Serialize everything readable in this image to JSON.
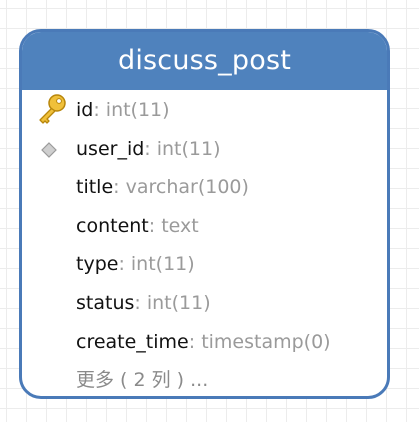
{
  "table": {
    "name": "discuss_post",
    "columns": [
      {
        "name": "id",
        "type": ": int(11)",
        "icon": "primary-key-icon"
      },
      {
        "name": "user_id",
        "type": ": int(11)",
        "icon": "index-diamond-icon"
      },
      {
        "name": "title",
        "type": ": varchar(100)",
        "icon": ""
      },
      {
        "name": "content",
        "type": ": text",
        "icon": ""
      },
      {
        "name": "type",
        "type": ": int(11)",
        "icon": ""
      },
      {
        "name": "status",
        "type": ": int(11)",
        "icon": ""
      },
      {
        "name": "create_time",
        "type": ": timestamp(0)",
        "icon": ""
      }
    ],
    "more_label": "更多 ( 2 列 ) ..."
  },
  "colors": {
    "header": "#4f82bd",
    "border": "#4a7ab8",
    "column_name": "#111111",
    "column_type": "#9a9a9a",
    "key_icon": "#e8b52c"
  }
}
